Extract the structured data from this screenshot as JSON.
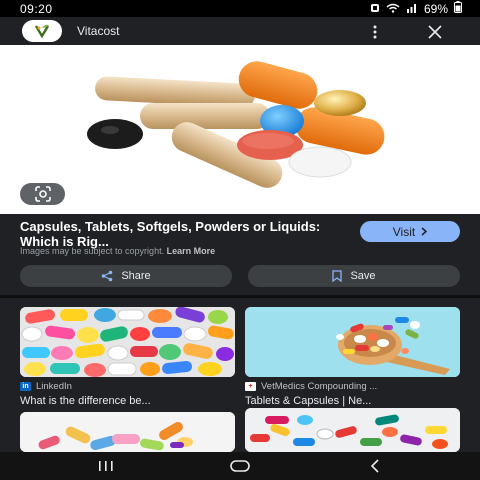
{
  "status_bar": {
    "time": "09:20",
    "battery": "69%"
  },
  "header": {
    "site_name": "Vitacost",
    "logo_text": "V"
  },
  "result": {
    "title": "Capsules, Tablets, Softgels, Powders or Liquids: Which is Rig...",
    "visit_label": "Visit",
    "copyright_text": "Images may be subject to copyright.",
    "learn_more": "Learn More",
    "share_label": "Share",
    "save_label": "Save"
  },
  "related": [
    {
      "source": "LinkedIn",
      "source_icon": "in",
      "title": "What is the difference be..."
    },
    {
      "source": "VetMedics Compounding ...",
      "source_icon": "+",
      "title": "Tablets & Capsules | Ne..."
    },
    {
      "source": "",
      "source_icon": "",
      "title": ""
    },
    {
      "source": "",
      "source_icon": "",
      "title": ""
    }
  ],
  "colors": {
    "accent": "#8ab4f8",
    "background": "#202124",
    "button": "#3c4043"
  }
}
